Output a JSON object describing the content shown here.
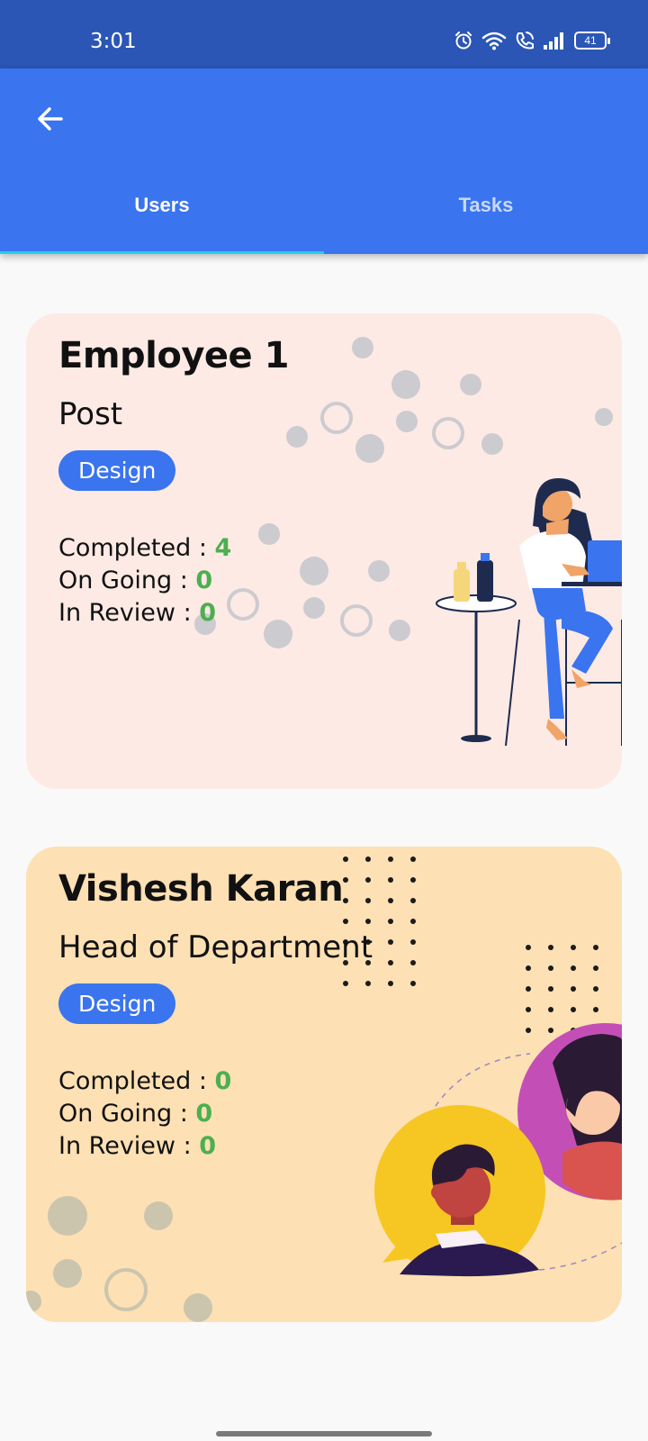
{
  "status_bar": {
    "time": "3:01",
    "battery": "41",
    "icons": [
      "alarm-icon",
      "wifi-icon",
      "wifi-calling-icon",
      "signal-icon",
      "battery-icon"
    ]
  },
  "app_bar": {
    "back_icon": "back-arrow-icon",
    "tabs": [
      {
        "label": "Users",
        "selected": true
      },
      {
        "label": "Tasks",
        "selected": false
      }
    ]
  },
  "cards": [
    {
      "name": "Employee 1",
      "post": "Post",
      "department": "Design",
      "background_color": "#fdeae5",
      "stats": [
        {
          "label": "Completed : ",
          "value": "4"
        },
        {
          "label": "On Going : ",
          "value": "0"
        },
        {
          "label": "In Review : ",
          "value": "0"
        }
      ]
    },
    {
      "name": "Vishesh Karan",
      "post": "Head of Department",
      "department": "Design",
      "background_color": "#fde0b4",
      "stats": [
        {
          "label": "Completed : ",
          "value": "0"
        },
        {
          "label": "On Going : ",
          "value": "0"
        },
        {
          "label": "In Review : ",
          "value": "0"
        }
      ]
    }
  ],
  "colors": {
    "status_bar": "#2b56b5",
    "primary": "#3a74ef",
    "tab_indicator": "#1fd0f0",
    "stat_value": "#4caf50"
  }
}
